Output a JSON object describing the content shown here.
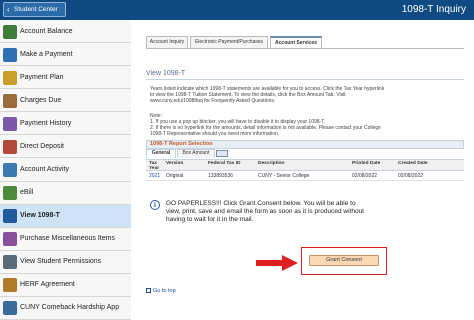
{
  "header": {
    "back_label": "Student Center",
    "page_title": "1098-T Inquiry"
  },
  "sidebar": {
    "items": [
      {
        "label": "Account Balance",
        "icon": "account-balance-icon",
        "color": "#3f7d3a"
      },
      {
        "label": "Make a Payment",
        "icon": "payment-icon",
        "color": "#2f6fb3"
      },
      {
        "label": "Payment Plan",
        "icon": "payment-plan-icon",
        "color": "#c9a02c"
      },
      {
        "label": "Charges Due",
        "icon": "charges-icon",
        "color": "#9a6b3b"
      },
      {
        "label": "Payment History",
        "icon": "history-icon",
        "color": "#7a5aa8"
      },
      {
        "label": "Direct Deposit",
        "icon": "direct-deposit-icon",
        "color": "#b24a3a"
      },
      {
        "label": "Account Activity",
        "icon": "activity-icon",
        "color": "#3a7ab0"
      },
      {
        "label": "eBill",
        "icon": "ebill-icon",
        "color": "#4d8a3a"
      },
      {
        "label": "View 1098-T",
        "icon": "form-icon",
        "color": "#1f5a9c"
      },
      {
        "label": "Purchase Miscellaneous Items",
        "icon": "purchase-icon",
        "color": "#8a4f9a"
      },
      {
        "label": "View Student Permissions",
        "icon": "permissions-icon",
        "color": "#5a6a7a"
      },
      {
        "label": "HERF Agreement",
        "icon": "agreement-icon",
        "color": "#b07a2a"
      },
      {
        "label": "CUNY Comeback Hardship App",
        "icon": "hardship-icon",
        "color": "#3a6a9a"
      }
    ],
    "active_index": 8
  },
  "tabs": [
    {
      "label": "Account Inquiry"
    },
    {
      "label": "Electronic Payment/Purchases"
    },
    {
      "label": "Account Services"
    }
  ],
  "section": {
    "title": "View 1098-T",
    "info_lines": [
      "Years listed indicate which 1098-T statements are available for you to access. Click the Tax Year hyperlink",
      "to view the 1098-T Tuition Statement. To view the details, click the Box Amount Tab. Visit",
      "www.cuny.edu/1098tfaq for Frequently Asked Questions."
    ],
    "note_lines": [
      "Note:",
      "1. If you use a pop up blocker, you will have to disable it to display your 1098-T.",
      "2. If there is no hyperlink for the amounts, detail information is not available. Please contact your College",
      "1098-T Representative should you need more information."
    ]
  },
  "report": {
    "title": "1098-T Report Selection",
    "subtabs": [
      "General",
      "Box Amount"
    ],
    "columns": [
      "Tax Year",
      "Version",
      "Federal Tax ID",
      "Description",
      "Printed Date",
      "Created Date"
    ],
    "rows": [
      [
        "2021",
        "Original",
        "133893536",
        "CUNY - Senior College",
        "02/08/2022",
        "02/08/2022"
      ]
    ]
  },
  "consent": {
    "message_lines": [
      "GO PAPERLESS!!! Click Grant Consent below. You will be able to",
      "view, print, save and email the form as soon as it is produced without",
      "having to wait for it in the mail."
    ],
    "button_label": "Grant Consent"
  },
  "footer": {
    "goto_label": "Go to top"
  },
  "colors": {
    "topbar": "#0f4a82",
    "highlight": "#e02020",
    "consent_button": "#f9d8b3"
  }
}
